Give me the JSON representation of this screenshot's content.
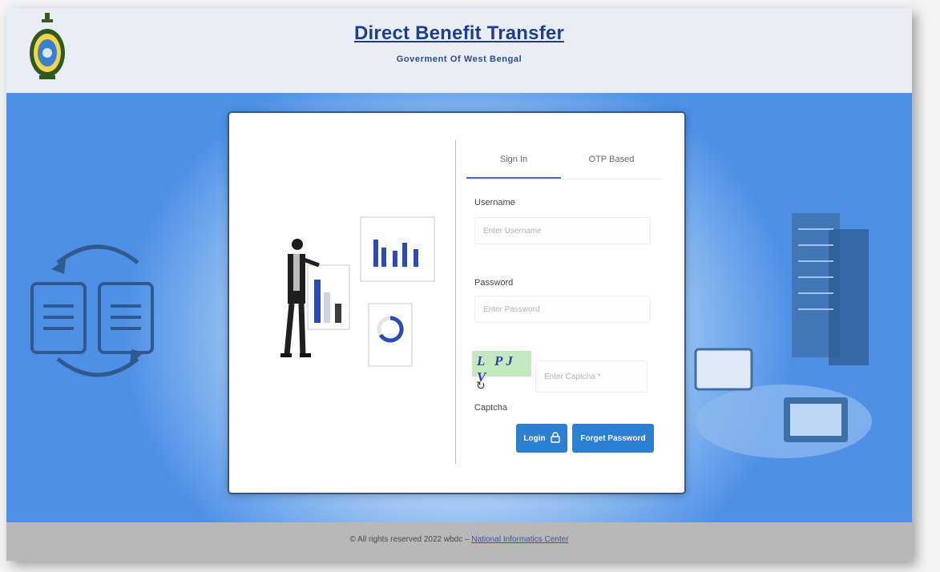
{
  "header": {
    "title": "Direct Benefit Transfer",
    "subtitle": "Goverment Of West Bengal"
  },
  "tabs": [
    {
      "label": "Sign In",
      "active": true
    },
    {
      "label": "OTP Based",
      "active": false
    }
  ],
  "form": {
    "username_label": "Username",
    "username_placeholder": "Enter Username",
    "password_label": "Password",
    "password_placeholder": "Enter Password",
    "captcha_image_text": "L PJ V",
    "captcha_placeholder": "Enter Captcha *",
    "captcha_label": "Captcha",
    "login_label": "Login",
    "forgot_label": "Forget Password"
  },
  "footer": {
    "text": "© All rights reserved 2022",
    "brand": "wbdc",
    "link_text": "National Informatics Center"
  },
  "colors": {
    "accent": "#2c7fd1",
    "title": "#1f3e8c",
    "hero_blue": "#4d90e6",
    "captcha_bg": "#c6e8c0"
  }
}
